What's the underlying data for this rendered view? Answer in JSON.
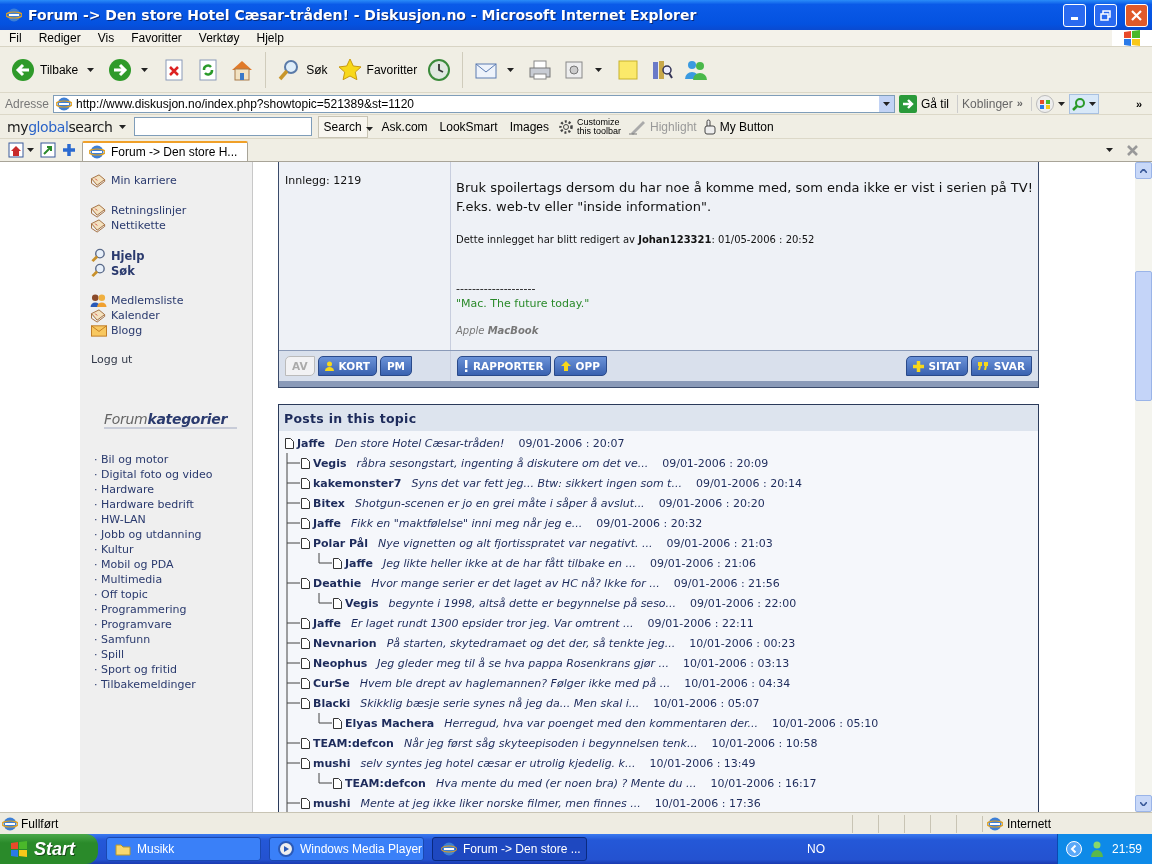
{
  "window": {
    "title": "Forum -> Den store Hotel Cæsar-tråden! - Diskusjon.no - Microsoft Internet Explorer"
  },
  "menu": [
    "Fil",
    "Rediger",
    "Vis",
    "Favoritter",
    "Verktøy",
    "Hjelp"
  ],
  "toolbar": [
    {
      "kind": "back",
      "label": "Tilbake",
      "has_menu": true
    },
    {
      "kind": "forward",
      "has_menu": true
    },
    {
      "kind": "stop",
      "has_menu": false
    },
    {
      "kind": "refresh",
      "has_menu": false
    },
    {
      "kind": "home",
      "has_menu": false
    },
    {
      "kind": "search",
      "label": "Søk",
      "has_menu": false
    },
    {
      "kind": "favorites",
      "label": "Favoritter",
      "has_menu": false
    },
    {
      "kind": "history",
      "has_menu": false
    },
    {
      "kind": "mail",
      "has_menu": true
    },
    {
      "kind": "print",
      "has_menu": false
    },
    {
      "kind": "edit",
      "has_menu": true
    },
    {
      "kind": "note",
      "has_menu": false
    },
    {
      "kind": "research",
      "has_menu": false
    },
    {
      "kind": "messenger",
      "has_menu": false
    }
  ],
  "address": {
    "label": "Adresse",
    "url": "http://www.diskusjon.no/index.php?showtopic=521389&st=1120",
    "go": "Gå til",
    "links": "Koblinger",
    "more": "»",
    "more_right": "»"
  },
  "search_toolbar": {
    "brand": [
      {
        "text": "my",
        "color": "#1a1a1a"
      },
      {
        "text": "global",
        "color": "#2a63c8"
      },
      {
        "text": "search",
        "color": "#1a1a1a"
      }
    ],
    "button": "Search",
    "links": [
      "Ask.com",
      "LookSmart",
      "Images"
    ],
    "customize": "Customize this toolbar",
    "highlight": {
      "label": "Highlight",
      "disabled": true
    },
    "my_button": "My Button"
  },
  "tabs": [
    {
      "label": "Forum -> Den store H...",
      "selected": true
    }
  ],
  "sidebar": {
    "groups": [
      [
        {
          "kind": "book",
          "label": "Min karriere"
        }
      ],
      [
        {
          "kind": "book",
          "label": "Retningslinjer"
        },
        {
          "kind": "book",
          "label": "Nettikette"
        }
      ],
      [
        {
          "kind": "search",
          "label": "Hjelp"
        },
        {
          "kind": "search",
          "label": "Søk"
        }
      ],
      [
        {
          "kind": "members",
          "label": "Medlemsliste"
        },
        {
          "kind": "book",
          "label": "Kalender"
        },
        {
          "kind": "mail",
          "label": "Blogg"
        }
      ]
    ],
    "logout": "Logg ut",
    "categories_title": "Forum**kategorier**",
    "categories": [
      "· Bil og motor",
      "· Digital foto og video",
      "· Hardware",
      "· Hardware bedrift",
      "· HW-LAN",
      "· Jobb og utdanning",
      "· Kultur",
      "· Mobil og PDA",
      "· Multimedia",
      "· Off topic",
      "· Programmering",
      "· Programvare",
      "· Samfunn",
      "· Spill",
      "· Sport og fritid",
      "· Tilbakemeldinger"
    ]
  },
  "post": {
    "count": "Innlegg: 1219",
    "body": [
      "Bruk spoilertags dersom du har noe å komme med, som enda ikke er vist i serien på TV!",
      "F.eks. web-tv eller \"inside information\"."
    ],
    "edited": "Dette innlegget har blitt redigert av **Johan123321**: 01/05-2006 : 20:52",
    "signature_rule": "--------------------",
    "signature": "\"Mac. The future today.\"",
    "device": "Apple **MacBook**",
    "profile_buttons": [
      {
        "kind": "av",
        "label": "AV",
        "disabled": true
      },
      {
        "kind": "card",
        "label": "KORT",
        "disabled": false
      },
      {
        "kind": "pm",
        "label": "PM",
        "disabled": false
      }
    ],
    "actions": [
      {
        "kind": "report",
        "label": "RAPPORTER"
      },
      {
        "kind": "up",
        "label": "OPP"
      }
    ],
    "reply_actions": [
      {
        "kind": "quote",
        "label": "SITAT"
      },
      {
        "kind": "reply",
        "label": "SVAR"
      }
    ]
  },
  "topic": {
    "title": "Posts in this topic",
    "posts": [
      {
        "author": "Jaffe",
        "excerpt": "Den store Hotel Cæsar-tråden!",
        "date": "09/01-2006 : 20:07",
        "children": [
          {
            "author": "Vegis",
            "excerpt": "råbra sesongstart, ingenting å diskutere om det ve...",
            "date": "09/01-2006 : 20:09"
          },
          {
            "author": "kakemonster7",
            "excerpt": "Syns det var fett jeg... Btw: sikkert ingen som t...",
            "date": "09/01-2006 : 20:14"
          },
          {
            "author": "Bitex",
            "excerpt": "Shotgun-scenen er jo en grei måte i såper å avslut...",
            "date": "09/01-2006 : 20:20"
          },
          {
            "author": "Jaffe",
            "excerpt": "Fikk en \"maktfølelse\" inni meg når jeg e...",
            "date": "09/01-2006 : 20:32"
          },
          {
            "author": "Polar Pål",
            "excerpt": "Nye vignetten og alt fjortisspratet var negativt. ...",
            "date": "09/01-2006 : 21:03",
            "children": [
              {
                "author": "Jaffe",
                "excerpt": "Jeg likte heller ikke at de har fått tilbake en ...",
                "date": "09/01-2006 : 21:06"
              }
            ]
          },
          {
            "author": "Deathie",
            "excerpt": "Hvor mange serier er det laget av HC nå? Ikke for ...",
            "date": "09/01-2006 : 21:56",
            "children": [
              {
                "author": "Vegis",
                "excerpt": "begynte i 1998, altså dette er begynnelse på seso...",
                "date": "09/01-2006 : 22:00"
              }
            ]
          },
          {
            "author": "Jaffe",
            "excerpt": "Er laget rundt 1300 epsider tror jeg. Var omtrent ...",
            "date": "09/01-2006 : 22:11"
          },
          {
            "author": "Nevnarion",
            "excerpt": "På starten, skytedramaet og det der, så tenkte jeg...",
            "date": "10/01-2006 : 00:23"
          },
          {
            "author": "Neophus",
            "excerpt": "Jeg gleder meg til å se hva pappa Rosenkrans gjør ...",
            "date": "10/01-2006 : 03:13"
          },
          {
            "author": "CurSe",
            "excerpt": "Hvem ble drept av haglemannen? Følger ikke med på ...",
            "date": "10/01-2006 : 04:34"
          },
          {
            "author": "Blacki",
            "excerpt": "Skikklig bæsje serie synes nå jeg da... Men skal i...",
            "date": "10/01-2006 : 05:07",
            "children": [
              {
                "author": "Elyas Machera",
                "excerpt": "Herregud, hva var poenget med den kommentaren der...",
                "date": "10/01-2006 : 05:10"
              }
            ]
          },
          {
            "author": "TEAM:defcon",
            "excerpt": "Når jeg først såg skyteepisoden i begynnelsen tenk...",
            "date": "10/01-2006 : 10:58"
          },
          {
            "author": "mushi",
            "excerpt": "selv syntes jeg hotel cæsar er utrolig kjedelig. k...",
            "date": "10/01-2006 : 13:49",
            "children": [
              {
                "author": "TEAM:defcon",
                "excerpt": "Hva mente du med (er noen bra) ? Mente du ...",
                "date": "10/01-2006 : 16:17"
              }
            ]
          },
          {
            "author": "mushi",
            "excerpt": "Mente at jeg ikke liker norske filmer, men finnes ...",
            "date": "10/01-2006 : 17:36"
          }
        ]
      }
    ]
  },
  "status_bar": {
    "text": "Fullført",
    "zone": "Internett"
  },
  "taskbar": {
    "start": "Start",
    "tasks": [
      {
        "kind": "folder",
        "label": "Musikk",
        "selected": false
      },
      {
        "kind": "media",
        "label": "Windows Media Player",
        "selected": false
      },
      {
        "kind": "ie",
        "label": "Forum -> Den store ...",
        "selected": true
      }
    ],
    "language": "NO",
    "clock": "21:59"
  }
}
